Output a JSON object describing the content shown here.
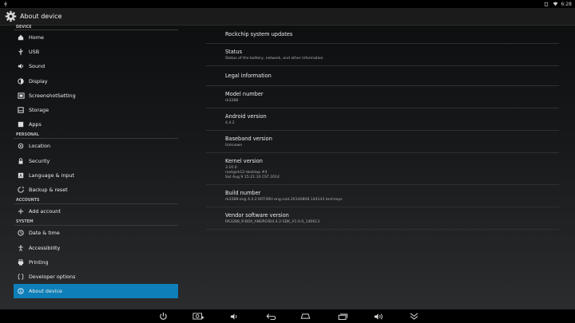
{
  "status": {
    "time": "6:28"
  },
  "actionbar": {
    "title": "About device"
  },
  "sidebar": {
    "sections": {
      "device": "DEVICE",
      "personal": "PERSONAL",
      "accounts": "ACCOUNTS",
      "system": "SYSTEM"
    },
    "items": [
      {
        "label": "Home",
        "icon": "home-icon"
      },
      {
        "label": "USB",
        "icon": "usb-icon"
      },
      {
        "label": "Sound",
        "icon": "sound-icon"
      },
      {
        "label": "Display",
        "icon": "display-icon"
      },
      {
        "label": "ScreenshotSetting",
        "icon": "screenshot-icon"
      },
      {
        "label": "Storage",
        "icon": "storage-icon"
      },
      {
        "label": "Apps",
        "icon": "apps-icon"
      },
      {
        "label": "Location",
        "icon": "location-icon"
      },
      {
        "label": "Security",
        "icon": "security-icon"
      },
      {
        "label": "Language & input",
        "icon": "language-icon"
      },
      {
        "label": "Backup & reset",
        "icon": "backup-icon"
      },
      {
        "label": "Add account",
        "icon": "add-icon"
      },
      {
        "label": "Date & time",
        "icon": "clock-icon"
      },
      {
        "label": "Accessibility",
        "icon": "accessibility-icon"
      },
      {
        "label": "Printing",
        "icon": "print-icon"
      },
      {
        "label": "Developer options",
        "icon": "code-icon"
      },
      {
        "label": "About device",
        "icon": "info-icon"
      }
    ]
  },
  "main": {
    "rockchip_updates": "Rockchip system updates",
    "status_title": "Status",
    "status_summary": "Status of the battery, network, and other information",
    "legal": "Legal information",
    "model_title": "Model number",
    "model_value": "rk3288",
    "android_title": "Android version",
    "android_value": "4.4.2",
    "baseband_title": "Baseband version",
    "baseband_value": "Unknown",
    "kernel_title": "Kernel version",
    "kernel_line1": "3.10.0",
    "kernel_line2": "root@rk12-desktop #4",
    "kernel_line3": "Sat Aug 9 15:21:10 CST 2014",
    "build_title": "Build number",
    "build_value": "rk3288-eng 4.4.2 KOT49H eng.root.20140808.144143 test-keys",
    "vendor_title": "Vendor software version",
    "vendor_value": "RK3288_R-BOX_ANDROID4.4.2-SDK_V1.0.0_140613"
  },
  "colors": {
    "accent": "#0e7fb8",
    "background": "#16181a"
  }
}
